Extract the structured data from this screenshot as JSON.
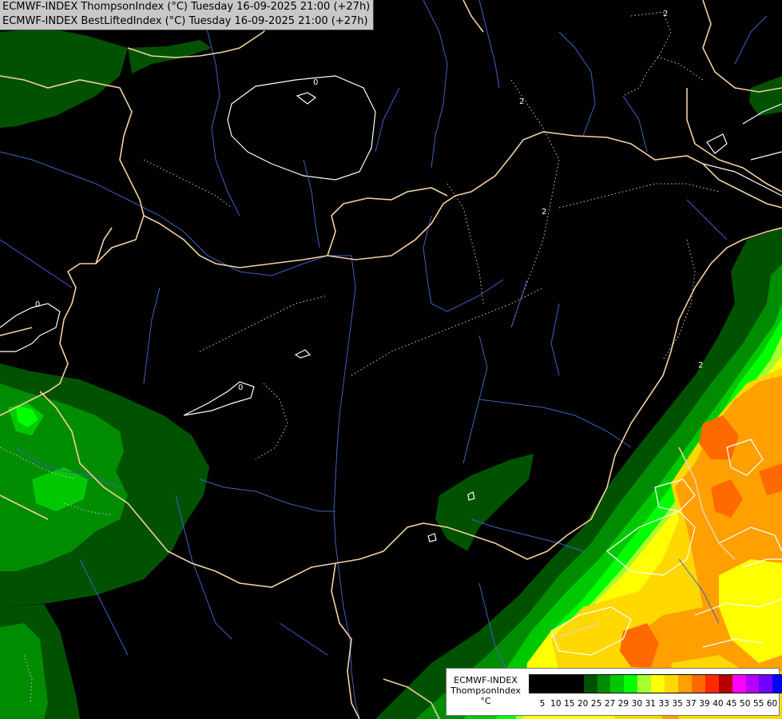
{
  "header": {
    "line1": "ECMWF-INDEX ThompsonIndex (°C) Tuesday 16-09-2025 21:00 (+27h)",
    "line2": "ECMWF-INDEX BestLiftedIndex (°C) Tuesday 16-09-2025 21:00 (+27h)"
  },
  "contour_labels": [
    "0",
    "0",
    "0",
    "2",
    "2",
    "2",
    "2"
  ],
  "legend": {
    "title": "ECMWF-INDEX",
    "subtitle": "ThompsonIndex",
    "unit": "°C",
    "ticks": [
      "5",
      "10",
      "15",
      "20",
      "25",
      "27",
      "29",
      "30",
      "31",
      "33",
      "35",
      "37",
      "39",
      "40",
      "45",
      "50",
      "55",
      "60"
    ],
    "colors": [
      "#000000",
      "#000000",
      "#000000",
      "#000000",
      "#005200",
      "#008c00",
      "#00c800",
      "#00ff00",
      "#a8ff30",
      "#ffff00",
      "#ffd800",
      "#ffa000",
      "#ff6a00",
      "#ff2a00",
      "#b40000",
      "#ff00ff",
      "#b400ff",
      "#7000ff",
      "#0000ff"
    ]
  },
  "colors": {
    "background": "#000000",
    "borders": "#f2d1a4",
    "rivers": "#4060c0",
    "isolines": "#ffffff"
  }
}
